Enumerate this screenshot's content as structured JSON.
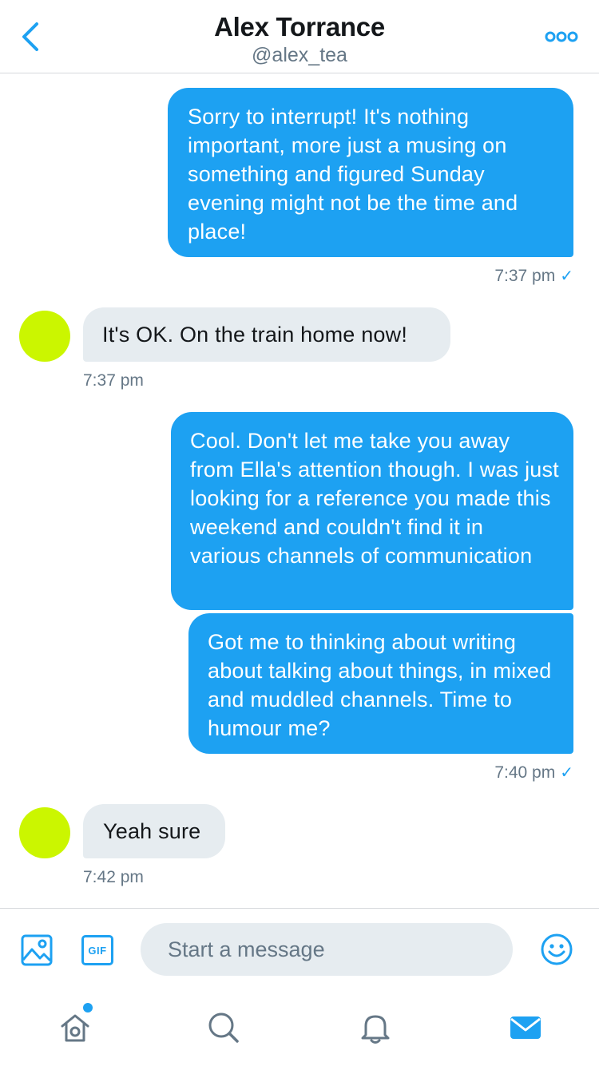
{
  "header": {
    "name": "Alex Torrance",
    "handle": "@alex_tea",
    "back_icon": "chevron-left-icon",
    "more_icon": "more-icon"
  },
  "messages": [
    {
      "direction": "outgoing",
      "text": "Sorry to interrupt! It's nothing important, more just a musing on something and figured Sunday evening might not be the time and place!"
    },
    {
      "direction": "outgoing",
      "timestamp": "7:37 pm",
      "read_receipt": "✓"
    },
    {
      "direction": "incoming",
      "text": "It's OK. On the train home now!",
      "timestamp": "7:37 pm"
    },
    {
      "direction": "outgoing",
      "text": "Cool. Don't let me take you away from Ella's attention though. I was just looking for a reference you made this weekend and couldn't find it in various channels of communication"
    },
    {
      "direction": "outgoing",
      "text": "Got me to thinking about writing about talking about things, in mixed and muddled channels. Time to humour me?"
    },
    {
      "direction": "outgoing",
      "timestamp": "7:40 pm",
      "read_receipt": "✓"
    },
    {
      "direction": "incoming",
      "text": "Yeah sure",
      "timestamp": "7:42 pm"
    }
  ],
  "composer": {
    "placeholder": "Start a message",
    "image_icon": "image-icon",
    "gif_label": "GIF",
    "emoji_icon": "emoji-icon"
  },
  "tabbar": {
    "items": [
      "home-icon",
      "search-icon",
      "notifications-icon",
      "messages-icon"
    ],
    "active": "messages-icon",
    "home_has_notification_dot": true
  },
  "colors": {
    "accent": "#1da1f2",
    "incoming_bubble": "#e6ecf0",
    "avatar": "#cbf600",
    "secondary_text": "#657786"
  }
}
